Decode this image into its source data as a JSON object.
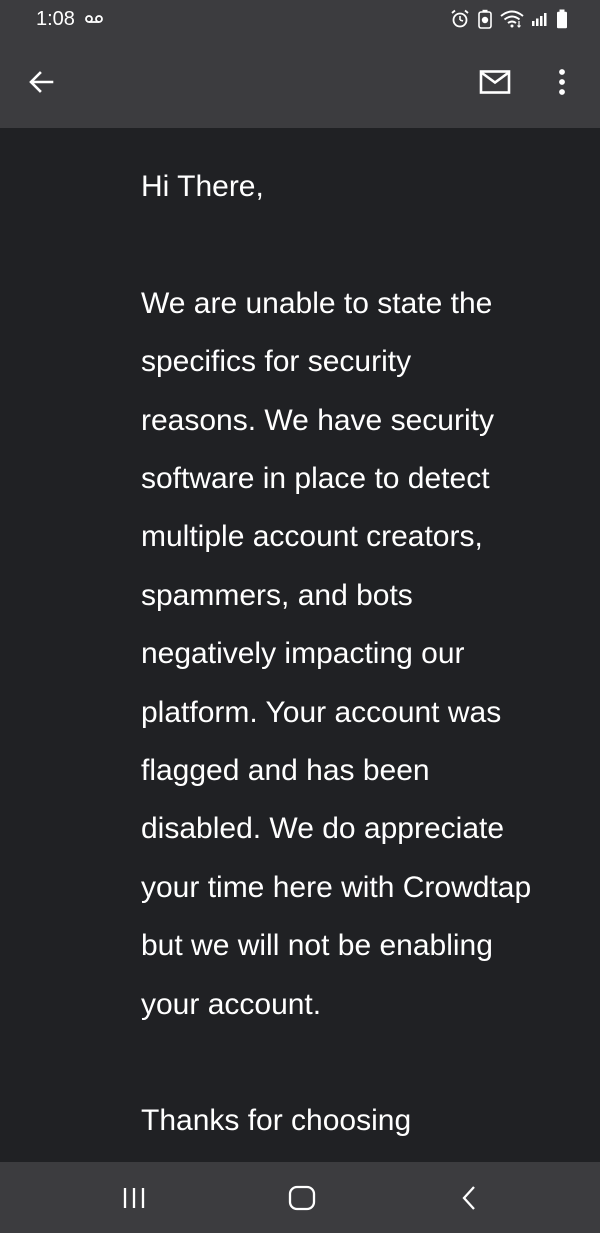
{
  "status_bar": {
    "time": "1:08",
    "icons": [
      "voicemail-icon",
      "alarm-icon",
      "battery-saver-icon",
      "wifi-icon",
      "signal-icon",
      "battery-icon"
    ]
  },
  "app_bar": {
    "icons": [
      "back-arrow-icon",
      "mail-icon",
      "more-vert-icon"
    ]
  },
  "message": {
    "greeting": "Hi There,",
    "body_lines": [
      "We are unable to state the",
      "specifics for security",
      "reasons. We have security",
      "software in place to detect",
      "multiple account creators,",
      "spammers, and bots",
      "negatively impacting our",
      "platform. Your account was",
      "flagged and has been",
      "disabled. We do appreciate",
      "your time here with Crowdtap",
      "but we will not be enabling",
      "your account."
    ],
    "closing": "Thanks for choosing"
  },
  "nav_bar": {
    "icons": [
      "recent-apps-icon",
      "home-icon",
      "back-icon"
    ]
  },
  "colors": {
    "background": "#202124",
    "bar": "#3c3c3f",
    "text": "#ffffff"
  }
}
